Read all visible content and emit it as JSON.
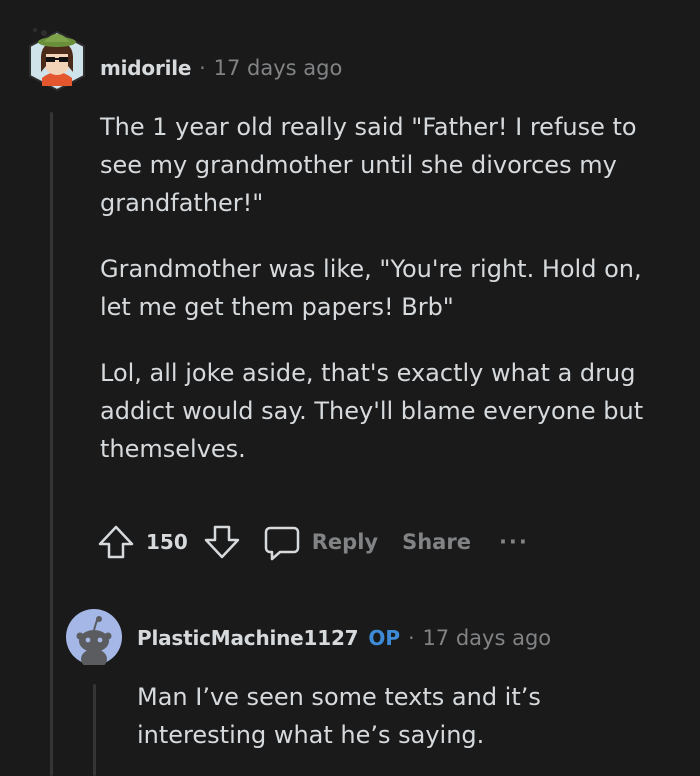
{
  "comment": {
    "username": "midorile",
    "separator": "·",
    "time": "17 days ago",
    "paragraphs": [
      "The 1 year old really said \"Father! I refuse to see my grandmother until she divorces my grandfather!\"",
      "Grandmother was like, \"You're right. Hold on, let me get them papers! Brb\"",
      "Lol, all joke aside, that's exactly what a drug addict would say. They'll blame everyone but themselves."
    ],
    "votes": "150",
    "reply_label": "Reply",
    "share_label": "Share",
    "more_label": "···"
  },
  "reply": {
    "username": "PlasticMachine1127",
    "op_badge": "OP",
    "separator": "·",
    "time": "17 days ago",
    "text": "Man I’ve seen some texts and it’s interesting what he’s saying."
  },
  "icons": {
    "upvote": "upvote-arrow-icon",
    "downvote": "downvote-arrow-icon",
    "reply": "speech-bubble-icon"
  },
  "colors": {
    "background": "#1a1a1b",
    "text": "#d7dadc",
    "muted": "#818384",
    "op_badge": "#3d8bd7"
  }
}
